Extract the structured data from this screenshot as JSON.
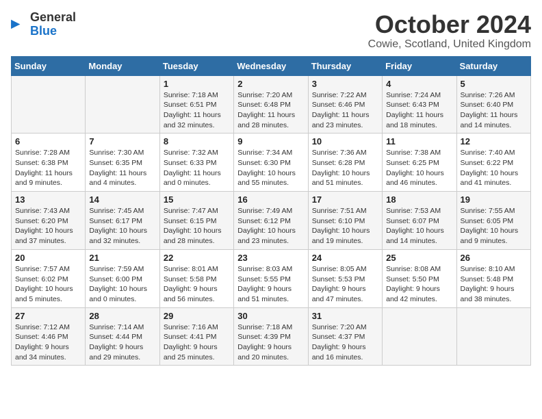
{
  "logo": {
    "text_general": "General",
    "text_blue": "Blue"
  },
  "title": {
    "month": "October 2024",
    "location": "Cowie, Scotland, United Kingdom"
  },
  "weekdays": [
    "Sunday",
    "Monday",
    "Tuesday",
    "Wednesday",
    "Thursday",
    "Friday",
    "Saturday"
  ],
  "weeks": [
    [
      {
        "day": "",
        "info": ""
      },
      {
        "day": "",
        "info": ""
      },
      {
        "day": "1",
        "info": "Sunrise: 7:18 AM\nSunset: 6:51 PM\nDaylight: 11 hours and 32 minutes."
      },
      {
        "day": "2",
        "info": "Sunrise: 7:20 AM\nSunset: 6:48 PM\nDaylight: 11 hours and 28 minutes."
      },
      {
        "day": "3",
        "info": "Sunrise: 7:22 AM\nSunset: 6:46 PM\nDaylight: 11 hours and 23 minutes."
      },
      {
        "day": "4",
        "info": "Sunrise: 7:24 AM\nSunset: 6:43 PM\nDaylight: 11 hours and 18 minutes."
      },
      {
        "day": "5",
        "info": "Sunrise: 7:26 AM\nSunset: 6:40 PM\nDaylight: 11 hours and 14 minutes."
      }
    ],
    [
      {
        "day": "6",
        "info": "Sunrise: 7:28 AM\nSunset: 6:38 PM\nDaylight: 11 hours and 9 minutes."
      },
      {
        "day": "7",
        "info": "Sunrise: 7:30 AM\nSunset: 6:35 PM\nDaylight: 11 hours and 4 minutes."
      },
      {
        "day": "8",
        "info": "Sunrise: 7:32 AM\nSunset: 6:33 PM\nDaylight: 11 hours and 0 minutes."
      },
      {
        "day": "9",
        "info": "Sunrise: 7:34 AM\nSunset: 6:30 PM\nDaylight: 10 hours and 55 minutes."
      },
      {
        "day": "10",
        "info": "Sunrise: 7:36 AM\nSunset: 6:28 PM\nDaylight: 10 hours and 51 minutes."
      },
      {
        "day": "11",
        "info": "Sunrise: 7:38 AM\nSunset: 6:25 PM\nDaylight: 10 hours and 46 minutes."
      },
      {
        "day": "12",
        "info": "Sunrise: 7:40 AM\nSunset: 6:22 PM\nDaylight: 10 hours and 41 minutes."
      }
    ],
    [
      {
        "day": "13",
        "info": "Sunrise: 7:43 AM\nSunset: 6:20 PM\nDaylight: 10 hours and 37 minutes."
      },
      {
        "day": "14",
        "info": "Sunrise: 7:45 AM\nSunset: 6:17 PM\nDaylight: 10 hours and 32 minutes."
      },
      {
        "day": "15",
        "info": "Sunrise: 7:47 AM\nSunset: 6:15 PM\nDaylight: 10 hours and 28 minutes."
      },
      {
        "day": "16",
        "info": "Sunrise: 7:49 AM\nSunset: 6:12 PM\nDaylight: 10 hours and 23 minutes."
      },
      {
        "day": "17",
        "info": "Sunrise: 7:51 AM\nSunset: 6:10 PM\nDaylight: 10 hours and 19 minutes."
      },
      {
        "day": "18",
        "info": "Sunrise: 7:53 AM\nSunset: 6:07 PM\nDaylight: 10 hours and 14 minutes."
      },
      {
        "day": "19",
        "info": "Sunrise: 7:55 AM\nSunset: 6:05 PM\nDaylight: 10 hours and 9 minutes."
      }
    ],
    [
      {
        "day": "20",
        "info": "Sunrise: 7:57 AM\nSunset: 6:02 PM\nDaylight: 10 hours and 5 minutes."
      },
      {
        "day": "21",
        "info": "Sunrise: 7:59 AM\nSunset: 6:00 PM\nDaylight: 10 hours and 0 minutes."
      },
      {
        "day": "22",
        "info": "Sunrise: 8:01 AM\nSunset: 5:58 PM\nDaylight: 9 hours and 56 minutes."
      },
      {
        "day": "23",
        "info": "Sunrise: 8:03 AM\nSunset: 5:55 PM\nDaylight: 9 hours and 51 minutes."
      },
      {
        "day": "24",
        "info": "Sunrise: 8:05 AM\nSunset: 5:53 PM\nDaylight: 9 hours and 47 minutes."
      },
      {
        "day": "25",
        "info": "Sunrise: 8:08 AM\nSunset: 5:50 PM\nDaylight: 9 hours and 42 minutes."
      },
      {
        "day": "26",
        "info": "Sunrise: 8:10 AM\nSunset: 5:48 PM\nDaylight: 9 hours and 38 minutes."
      }
    ],
    [
      {
        "day": "27",
        "info": "Sunrise: 7:12 AM\nSunset: 4:46 PM\nDaylight: 9 hours and 34 minutes."
      },
      {
        "day": "28",
        "info": "Sunrise: 7:14 AM\nSunset: 4:44 PM\nDaylight: 9 hours and 29 minutes."
      },
      {
        "day": "29",
        "info": "Sunrise: 7:16 AM\nSunset: 4:41 PM\nDaylight: 9 hours and 25 minutes."
      },
      {
        "day": "30",
        "info": "Sunrise: 7:18 AM\nSunset: 4:39 PM\nDaylight: 9 hours and 20 minutes."
      },
      {
        "day": "31",
        "info": "Sunrise: 7:20 AM\nSunset: 4:37 PM\nDaylight: 9 hours and 16 minutes."
      },
      {
        "day": "",
        "info": ""
      },
      {
        "day": "",
        "info": ""
      }
    ]
  ]
}
